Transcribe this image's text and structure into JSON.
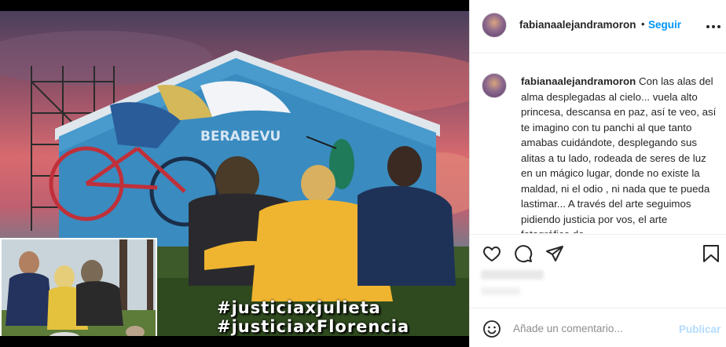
{
  "post": {
    "hashtag_1": "#justiciaxjulieta",
    "hashtag_2": "#justiciaxFlorencia",
    "mural_text": "BERABEVU"
  },
  "header": {
    "username": "fabianaalejandramoron",
    "separator": "•",
    "follow_label": "Seguir",
    "more_icon": "more-horizontal-icon"
  },
  "caption": {
    "username": "fabianaalejandramoron",
    "text": "Con las alas del alma desplegadas al cielo... vuela alto princesa, descansa en paz, así te veo, así te imagino con tu panchi al que tanto amabas cuidándote, desplegando sus alitas a tu lado, rodeada de seres de luz en un mágico lugar, donde no existe la maldad, ni el odio , ni nada que te pueda lastimar... A través del arte seguimos pidiendo justicia por vos, el arte fotográfico de"
  },
  "actions": {
    "like_icon": "heart-icon",
    "comment_icon": "comment-icon",
    "share_icon": "send-icon",
    "save_icon": "bookmark-icon"
  },
  "comment_box": {
    "placeholder": "Añade un comentario...",
    "publish_label": "Publicar",
    "emoji_icon": "emoji-icon"
  },
  "colors": {
    "accent": "#0095f6",
    "publish_disabled": "#b3dbff",
    "text": "#262626",
    "muted": "#8e8e8e"
  }
}
